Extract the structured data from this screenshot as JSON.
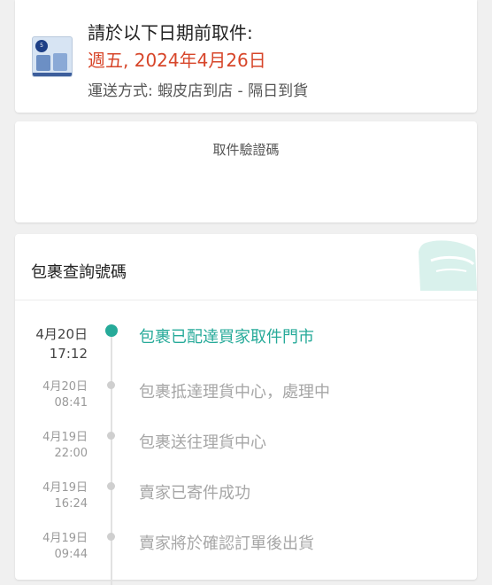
{
  "pickup": {
    "title": "請於以下日期前取件:",
    "deadline": "週五, 2024年4月26日",
    "shipping": "運送方式: 蝦皮店到店 - 隔日到貨",
    "thumb_badge": "5",
    "deadline_color": "#d7462a"
  },
  "code_card": {
    "label": "取件驗證碼"
  },
  "tracking": {
    "title": "包裹查詢號碼",
    "accent_color": "#26aa99",
    "events": [
      {
        "date": "4月20日",
        "time": "17:12",
        "text": "包裹已配達買家取件門市"
      },
      {
        "date": "4月20日",
        "time": "08:41",
        "text": "包裹抵達理貨中心，處理中"
      },
      {
        "date": "4月19日",
        "time": "22:00",
        "text": "包裹送往理貨中心"
      },
      {
        "date": "4月19日",
        "time": "16:24",
        "text": "賣家已寄件成功"
      },
      {
        "date": "4月19日",
        "time": "09:44",
        "text": "賣家將於確認訂單後出貨"
      }
    ]
  }
}
